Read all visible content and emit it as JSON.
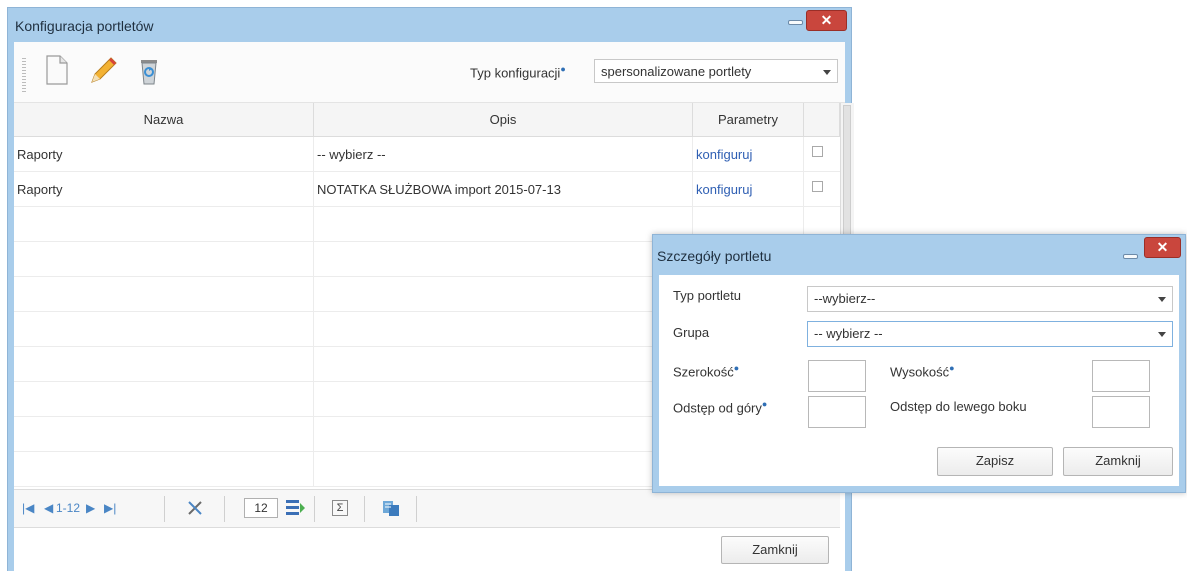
{
  "main_window": {
    "title": "Konfiguracja portletów",
    "toolbar": {
      "icons": [
        "new-document-icon",
        "edit-pencil-icon",
        "recycle-bin-icon"
      ],
      "typ_label": "Typ konfiguracji",
      "typ_value": "spersonalizowane portlety"
    },
    "columns": [
      "Nazwa",
      "Opis",
      "Parametry"
    ],
    "rows": [
      {
        "nazwa": "Raporty",
        "opis": "-- wybierz --",
        "parametry": "konfiguruj"
      },
      {
        "nazwa": "Raporty",
        "opis": "NOTATKA SŁUŻBOWA import 2015-07-13",
        "parametry": "konfiguruj"
      }
    ],
    "pager": {
      "range": "1-12",
      "page_size": "12"
    },
    "close_button": "Zamknij"
  },
  "details_dialog": {
    "title": "Szczegóły portletu",
    "typ_label": "Typ portletu",
    "typ_value": "--wybierz--",
    "grupa_label": "Grupa",
    "grupa_value": "-- wybierz --",
    "szerokosc_label": "Szerokość",
    "wysokosc_label": "Wysokość",
    "odstep_gory_label": "Odstęp od góry",
    "odstep_lewego_label": "Odstęp do lewego boku",
    "save_button": "Zapisz",
    "close_button": "Zamknij"
  },
  "colors": {
    "frame": "#a9cdeb",
    "close": "#c9463d",
    "link": "#2f5fb3"
  }
}
